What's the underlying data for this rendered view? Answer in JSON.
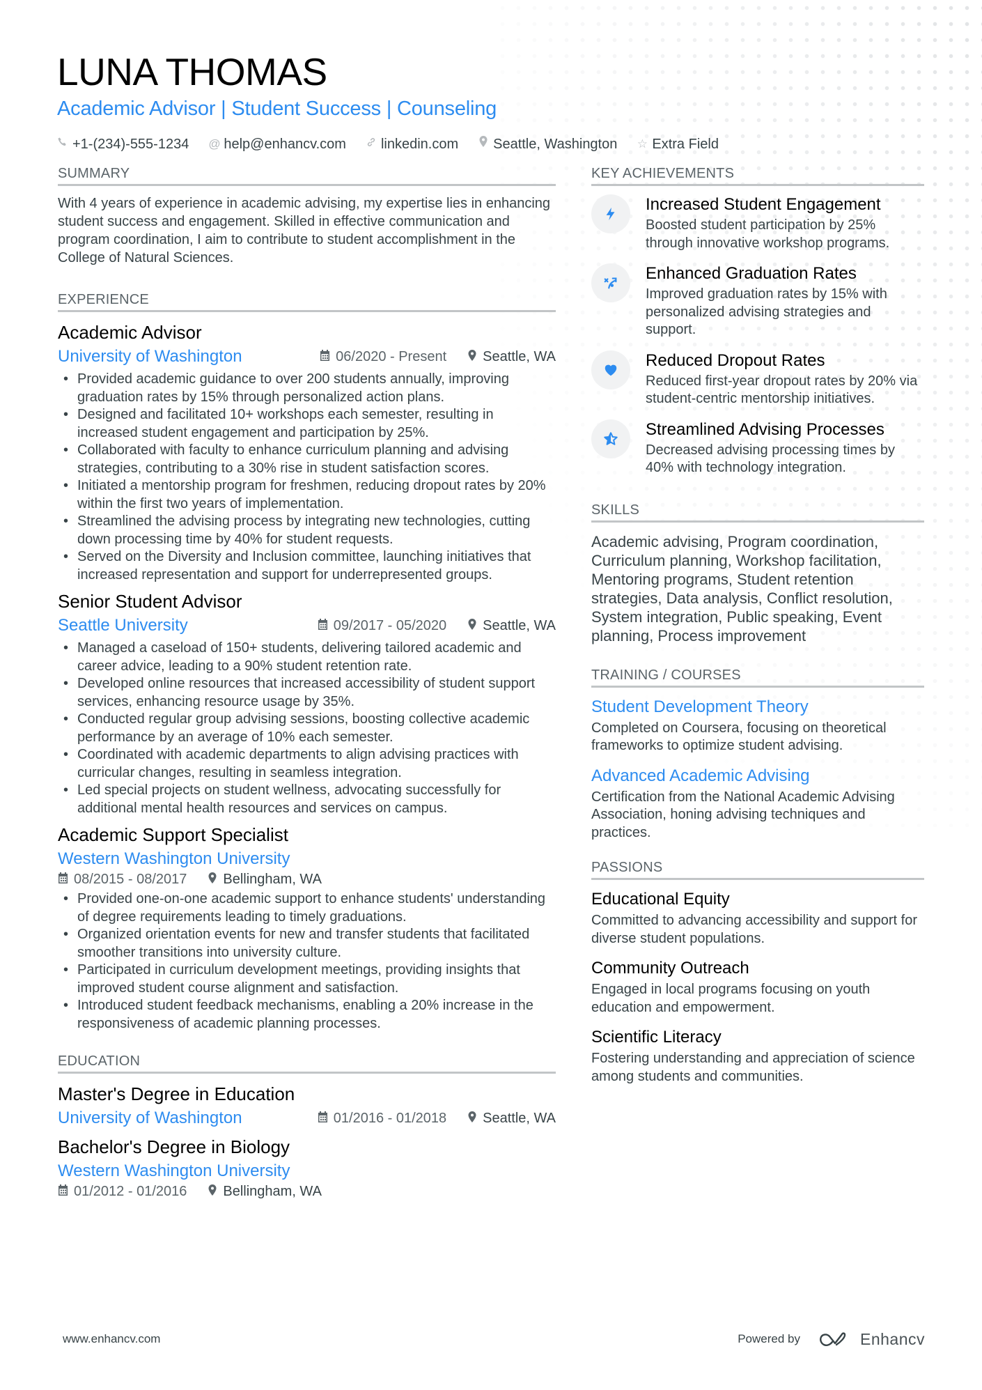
{
  "header": {
    "name": "LUNA THOMAS",
    "title": "Academic Advisor | Student Success | Counseling",
    "contacts": [
      {
        "icon": "phone-icon",
        "text": "+1-(234)-555-1234"
      },
      {
        "icon": "at-icon",
        "text": "help@enhancv.com"
      },
      {
        "icon": "link-icon",
        "text": "linkedin.com"
      },
      {
        "icon": "location-pin-icon",
        "text": "Seattle, Washington"
      },
      {
        "icon": "star-icon",
        "text": "Extra Field"
      }
    ]
  },
  "summary": {
    "heading": "SUMMARY",
    "text": "With 4 years of experience in academic advising, my expertise lies in enhancing student success and engagement. Skilled in effective communication and program coordination, I aim to contribute to student accomplishment in the College of Natural Sciences."
  },
  "experience": {
    "heading": "EXPERIENCE",
    "jobs": [
      {
        "title": "Academic Advisor",
        "company": "University of Washington",
        "dates": "06/2020 - Present",
        "location": "Seattle, WA",
        "bullets": [
          "Provided academic guidance to over 200 students annually, improving graduation rates by 15% through personalized action plans.",
          "Designed and facilitated 10+ workshops each semester, resulting in increased student engagement and participation by 25%.",
          "Collaborated with faculty to enhance curriculum planning and advising strategies, contributing to a 30% rise in student satisfaction scores.",
          "Initiated a mentorship program for freshmen, reducing dropout rates by 20% within the first two years of implementation.",
          "Streamlined the advising process by integrating new technologies, cutting down processing time by 40% for student requests.",
          "Served on the Diversity and Inclusion committee, launching initiatives that increased representation and support for underrepresented groups."
        ]
      },
      {
        "title": "Senior Student Advisor",
        "company": "Seattle University",
        "dates": "09/2017 - 05/2020",
        "location": "Seattle, WA",
        "bullets": [
          "Managed a caseload of 150+ students, delivering tailored academic and career advice, leading to a 90% student retention rate.",
          "Developed online resources that increased accessibility of student support services, enhancing resource usage by 35%.",
          "Conducted regular group advising sessions, boosting collective academic performance by an average of 10% each semester.",
          "Coordinated with academic departments to align advising practices with curricular changes, resulting in seamless integration.",
          "Led special projects on student wellness, advocating successfully for additional mental health resources and services on campus."
        ]
      },
      {
        "title": "Academic Support Specialist",
        "company": "Western Washington University",
        "dates": "08/2015 - 08/2017",
        "location": "Bellingham, WA",
        "bullets": [
          "Provided one-on-one academic support to enhance students' understanding of degree requirements leading to timely graduations.",
          "Organized orientation events for new and transfer students that facilitated smoother transitions into university culture.",
          "Participated in curriculum development meetings, providing insights that improved student course alignment and satisfaction.",
          "Introduced student feedback mechanisms, enabling a 20% increase in the responsiveness of academic planning processes."
        ]
      }
    ]
  },
  "education": {
    "heading": "EDUCATION",
    "items": [
      {
        "degree": "Master's Degree in Education",
        "school": "University of Washington",
        "dates": "01/2016 - 01/2018",
        "location": "Seattle, WA"
      },
      {
        "degree": "Bachelor's Degree in Biology",
        "school": "Western Washington University",
        "dates": "01/2012 - 01/2016",
        "location": "Bellingham, WA"
      }
    ]
  },
  "achievements": {
    "heading": "KEY ACHIEVEMENTS",
    "items": [
      {
        "icon": "lightning-bolt-icon",
        "title": "Increased Student Engagement",
        "desc": "Boosted student participation by 25% through innovative workshop programs."
      },
      {
        "icon": "strategy-arrow-icon",
        "title": "Enhanced Graduation Rates",
        "desc": "Improved graduation rates by 15% with personalized advising strategies and support."
      },
      {
        "icon": "heart-icon",
        "title": "Reduced Dropout Rates",
        "desc": "Reduced first-year dropout rates by 20% via student-centric mentorship initiatives."
      },
      {
        "icon": "half-star-icon",
        "title": "Streamlined Advising Processes",
        "desc": "Decreased advising processing times by 40% with technology integration."
      }
    ]
  },
  "skills": {
    "heading": "SKILLS",
    "text": "Academic advising, Program coordination, Curriculum planning, Workshop facilitation, Mentoring programs, Student retention strategies, Data analysis, Conflict resolution, System integration, Public speaking, Event planning, Process improvement"
  },
  "training": {
    "heading": "TRAINING / COURSES",
    "items": [
      {
        "title": "Student Development Theory",
        "desc": "Completed on Coursera, focusing on theoretical frameworks to optimize student advising."
      },
      {
        "title": "Advanced Academic Advising",
        "desc": "Certification from the National Academic Advising Association, honing advising techniques and practices."
      }
    ]
  },
  "passions": {
    "heading": "PASSIONS",
    "items": [
      {
        "title": "Educational Equity",
        "desc": "Committed to advancing accessibility and support for diverse student populations."
      },
      {
        "title": "Community Outreach",
        "desc": "Engaged in local programs focusing on youth education and empowerment."
      },
      {
        "title": "Scientific Literacy",
        "desc": "Fostering understanding and appreciation of science among students and communities."
      }
    ]
  },
  "footer": {
    "website": "www.enhancv.com",
    "powered_by": "Powered by",
    "brand": "Enhancv"
  },
  "colors": {
    "accent": "#2d8cf0",
    "text": "#384347",
    "heading": "#000000",
    "muted": "#5b6469",
    "rule": "#c2c5c7"
  }
}
